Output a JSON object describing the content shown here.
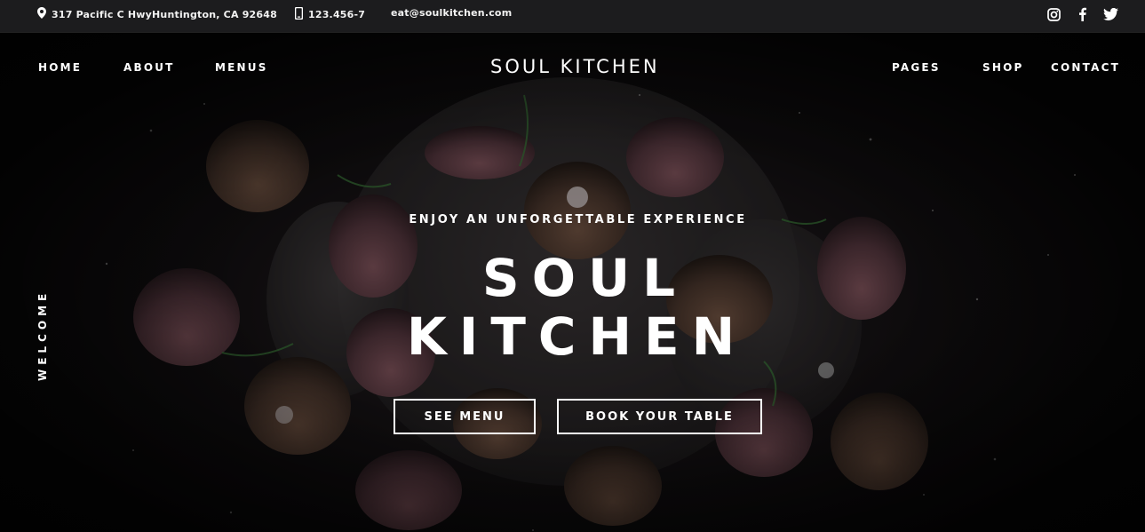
{
  "topbar": {
    "address": "317 Pacific C HwyHuntington, CA 92648",
    "phone": "123.456-7",
    "email": "eat@soulkitchen.com",
    "social": [
      "instagram-icon",
      "facebook-icon",
      "twitter-icon"
    ]
  },
  "nav": {
    "left": [
      "HOME",
      "ABOUT",
      "MENUS"
    ],
    "brand": "SOUL KITCHEN",
    "right": [
      "PAGES",
      "SHOP",
      "CONTACT"
    ]
  },
  "hero": {
    "side_label": "WELCOME",
    "kicker": "ENJOY AN UNFORGETTABLE EXPERIENCE",
    "title_line1": "SOUL",
    "title_line2": "KITCHEN",
    "buttons": [
      "SEE MENU",
      "BOOK YOUR TABLE"
    ]
  },
  "colors": {
    "topbar_bg": "#1c1c1e",
    "hero_bg": "#0b0b0c",
    "text": "#ffffff"
  }
}
